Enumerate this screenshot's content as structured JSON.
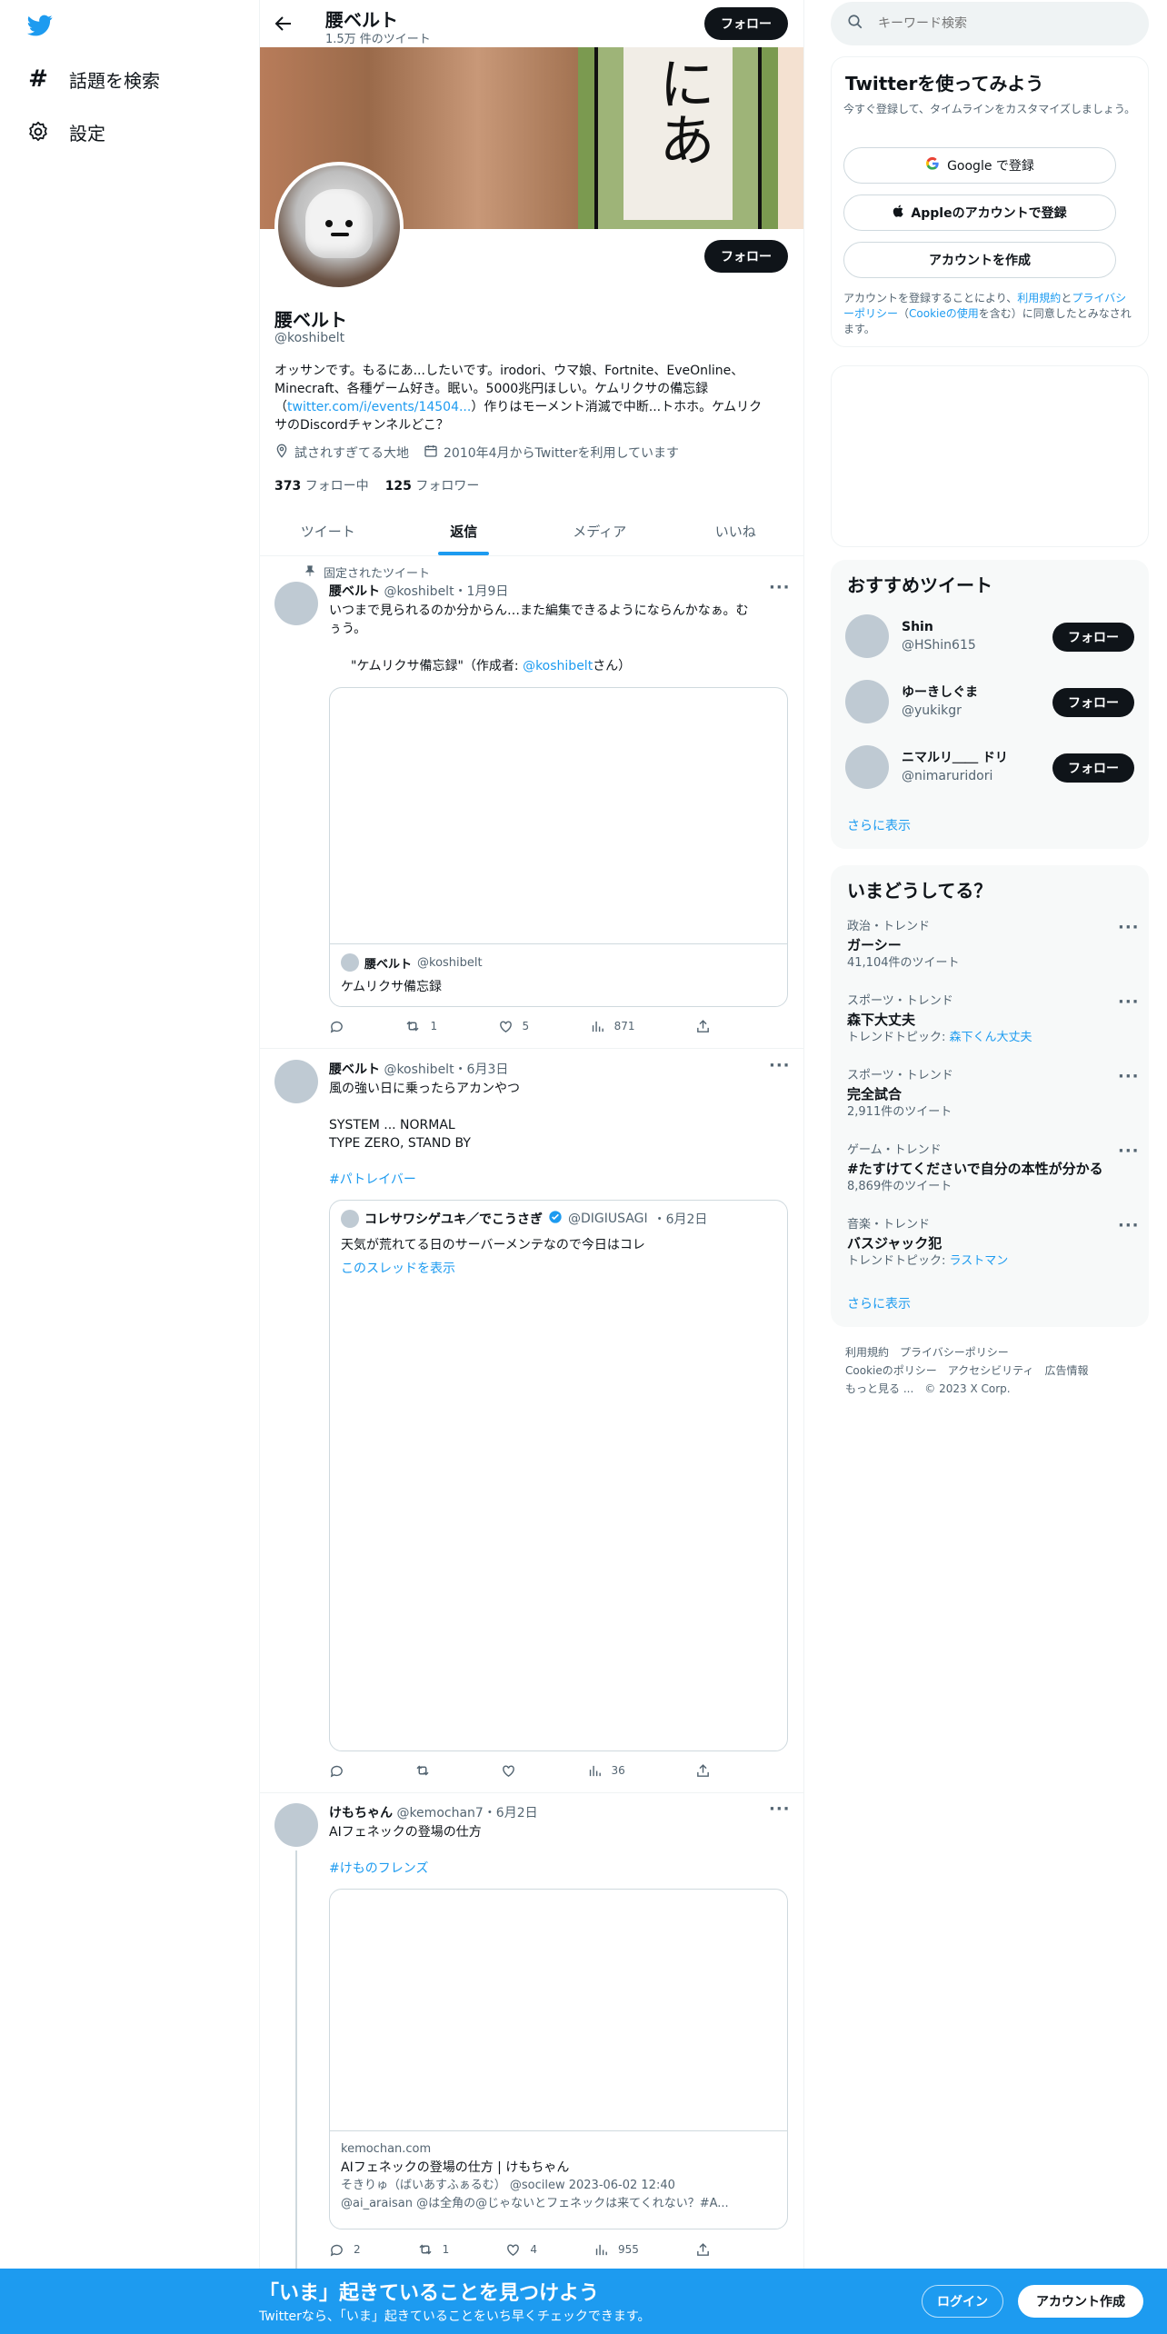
{
  "sidebar": {
    "items": [
      {
        "label": "話題を検索",
        "icon": "hashtag-icon"
      },
      {
        "label": "設定",
        "icon": "gear-icon"
      }
    ]
  },
  "header": {
    "name": "腰ベルト",
    "tweet_count": "1.5万 件のツイート",
    "follow_label": "フォロー"
  },
  "profile": {
    "banner_text": "にあ",
    "name": "腰ベルト",
    "handle": "@koshibelt",
    "follow_label": "フォロー",
    "bio_1": "オッサンです。もるにあ...したいです。irodori、ウマ娘、Fortnite、EveOnline、",
    "bio_2": "Minecraft、各種ゲーム好き。眠い。5000兆円ほしい。ケムリクサの備忘録",
    "bio_3a": "（",
    "bio_link": "twitter.com/i/events/14504...",
    "bio_3b": "）作りはモーメント消滅で中断...トホホ。ケムリク",
    "bio_4": "サのDiscordチャンネルどこ？",
    "location": "試されすぎてる大地",
    "joined": "2010年4月からTwitterを利用しています",
    "following_count": "373",
    "following_label": "フォロー中",
    "followers_count": "125",
    "followers_label": "フォロワー"
  },
  "tabs": [
    {
      "label": "ツイート",
      "active": false
    },
    {
      "label": "返信",
      "active": true
    },
    {
      "label": "メディア",
      "active": false
    },
    {
      "label": "いいね",
      "active": false
    }
  ],
  "tweet1": {
    "pinned_label": "固定されたツイート",
    "name": "腰ベルト",
    "handle": "@koshibelt",
    "date": "・1月9日",
    "text_1": "いつまで見られるのか分からん…また編集できるようにならんかなぁ。む",
    "text_2": "ぅう。",
    "quote_pre": "\"ケムリクサ備忘録\"（作成者: ",
    "quote_mention": "@koshibelt",
    "quote_post": "さん）",
    "card_name": "腰ベルト",
    "card_handle": "@koshibelt",
    "card_text": "ケムリクサ備忘録",
    "retweets": "1",
    "likes": "5",
    "views": "871"
  },
  "tweet2": {
    "name": "腰ベルト",
    "handle": "@koshibelt",
    "date": "・6月3日",
    "text_1": "風の強い日に乗ったらアカンやつ",
    "text_2": "SYSTEM ... NORMAL",
    "text_3": "TYPE ZERO, STAND BY",
    "hashtag": "#パトレイバー",
    "quote_name": "コレサワシゲユキ／でこうさぎ",
    "quote_handle": "@DIGIUSAGI",
    "quote_date": "・6月2日",
    "quote_text": "天気が荒れてる日のサーバーメンテなので今日はコレ",
    "quote_thread": "このスレッドを表示",
    "views": "36"
  },
  "tweet3": {
    "name": "けもちゃん",
    "handle": "@kemochan7",
    "date": "・6月2日",
    "text_1": "AIフェネックの登場の仕方",
    "hashtag": "#けものフレンズ",
    "card_domain": "kemochan.com",
    "card_title": "AIフェネックの登場の仕方 | けもちゃん",
    "card_line1": "そきりゅ（ばいあすふぁるむ） @socilew 2023-06-02 12:40",
    "card_line2": "@ai_araisan @は全角の@じゃないとフェネックは来てくれない？#A...",
    "replies": "2",
    "retweets": "1",
    "likes": "4",
    "views": "955"
  },
  "search": {
    "placeholder": "キーワード検索"
  },
  "signup": {
    "title": "Twitterを使ってみよう",
    "subtitle": "今すぐ登録して、タイムラインをカスタマイズしましょう。",
    "google_label": "Google で登録",
    "apple_label": "Appleのアカウントで登録",
    "create_label": "アカウントを作成",
    "legal_1": "アカウントを登録することにより、",
    "legal_terms": "利用規約",
    "legal_2": "と",
    "legal_privacy": "プライバシーポリシー",
    "legal_3": "（",
    "legal_cookie": "Cookieの使用",
    "legal_4": "を含む）に同意したとみなされます。"
  },
  "recommended": {
    "title": "おすすめツイート",
    "follow_label": "フォロー",
    "users": [
      {
        "name": "Shin",
        "handle": "@HShin615"
      },
      {
        "name": "ゆーきしぐま",
        "handle": "@yukikgr"
      },
      {
        "name": "ニマルリ＿＿ ドリ",
        "handle": "@nimaruridori"
      }
    ],
    "more": "さらに表示"
  },
  "trends": {
    "title": "いまどうしてる？",
    "items": [
      {
        "meta": "政治・トレンド",
        "name": "ガーシー",
        "sub": "41,104件のツイート",
        "sub_link": ""
      },
      {
        "meta": "スポーツ・トレンド",
        "name": "森下大丈夫",
        "sub": "トレンドトピック: ",
        "sub_link": "森下くん大丈夫"
      },
      {
        "meta": "スポーツ・トレンド",
        "name": "完全試合",
        "sub": "2,911件のツイート",
        "sub_link": ""
      },
      {
        "meta": "ゲーム・トレンド",
        "name": "#たすけてくださいで自分の本性が分かる",
        "sub": "8,869件のツイート",
        "sub_link": ""
      },
      {
        "meta": "音楽・トレンド",
        "name": "バスジャック犯",
        "sub": "トレンドトピック: ",
        "sub_link": "ラストマン"
      }
    ],
    "more": "さらに表示"
  },
  "footer": {
    "terms": "利用規約",
    "privacy": "プライバシーポリシー",
    "cookie": "Cookieのポリシー",
    "accessibility": "アクセシビリティ",
    "ads": "広告情報",
    "more": "もっと見る ...",
    "copyright": "© 2023 X Corp."
  },
  "bottom_bar": {
    "title": "「いま」起きていることを見つけよう",
    "subtitle": "Twitterなら、「いま」起きていることをいち早くチェックできます。",
    "login_label": "ログイン",
    "signup_label": "アカウント作成"
  },
  "colors": {
    "accent": "#1d9bf0",
    "dark": "#0f1419",
    "muted": "#536471"
  }
}
